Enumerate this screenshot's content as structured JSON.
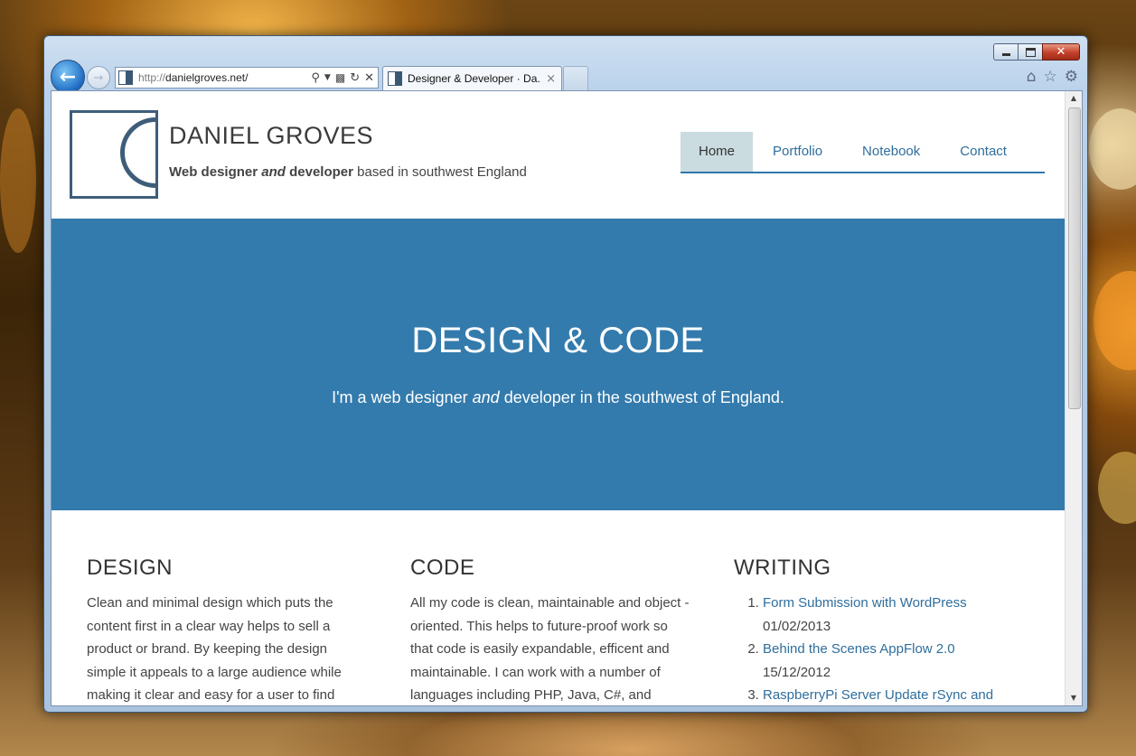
{
  "browser": {
    "address": {
      "scheme": "http://",
      "host": "danielgroves.net/"
    },
    "tab_title": "Designer & Developer · Da...",
    "tab_close": "×",
    "window_close": "✕"
  },
  "site": {
    "title": "DANIEL GROVES",
    "tagline": {
      "bold1": "Web designer",
      "italic": "and",
      "bold2": "developer",
      "rest": "based in southwest England"
    },
    "nav": [
      {
        "label": "Home",
        "active": true
      },
      {
        "label": "Portfolio",
        "active": false
      },
      {
        "label": "Notebook",
        "active": false
      },
      {
        "label": "Contact",
        "active": false
      }
    ]
  },
  "hero": {
    "title": "DESIGN & CODE",
    "sub_before": "I'm a web designer",
    "sub_italic": "and",
    "sub_after": "developer in the southwest of England."
  },
  "columns": {
    "design": {
      "heading": "DESIGN",
      "text": "Clean and minimal design which puts the content first in a clear way helps to sell a product or brand. By keeping the design simple it appeals to a large audience while making it clear and easy for a user to find"
    },
    "code": {
      "heading": "CODE",
      "text": "All my code is clean, maintainable and object -oriented. This helps to future-proof work so that code is easily expandable, efficent and maintainable. I can work with a number of languages including PHP, Java, C#, and"
    },
    "writing": {
      "heading": "WRITING",
      "posts": [
        {
          "title": "Form Submission with WordPress",
          "date": "01/02/2013"
        },
        {
          "title": "Behind the Scenes AppFlow 2.0",
          "date": "15/12/2012"
        },
        {
          "title": "RaspberryPi Server Update rSync and",
          "date": ""
        }
      ]
    }
  },
  "colors": {
    "accent": "#337aad",
    "link": "#2f6e9d",
    "nav_active_bg": "#cbdce1",
    "logo": "#3e5d78"
  }
}
